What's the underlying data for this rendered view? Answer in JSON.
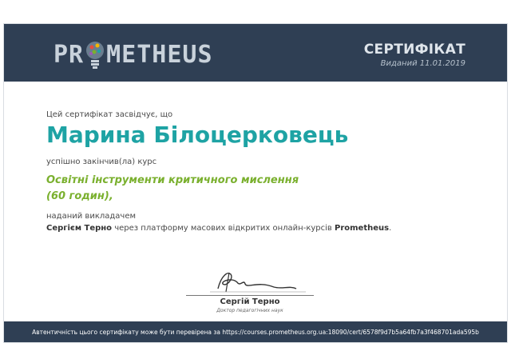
{
  "header": {
    "logo_left": "PR",
    "logo_right": "METHEUS",
    "title": "СЕРТИФІКАТ",
    "issued": "Виданий 11.01.2019"
  },
  "body": {
    "certifies": "Цей сертифікат засвідчує, що",
    "recipient": "Марина Білоцерковець",
    "completed": "успішно закінчив(ла) курс",
    "course_line1": "Освітні інструменти критичного мислення",
    "course_line2": "(60 годин),",
    "taught_by": "наданий викладачем",
    "teacher": "Сергієм Терно",
    "via_text": " через платформу масових відкритих онлайн-курсів ",
    "platform": "Prometheus",
    "period": "."
  },
  "signature": {
    "name": "Сергій Терно",
    "role": "Доктор педагогічних наук"
  },
  "footer": {
    "verify": "Автентичність цього сертифікату може бути перевірена за https://courses.prometheus.org.ua:18090/cert/6578f9d7b5a64fb7a3f468701ada595b"
  },
  "colors": {
    "header_bg": "#2f3f54",
    "name": "#1ea3a4",
    "course": "#7ab02e"
  }
}
